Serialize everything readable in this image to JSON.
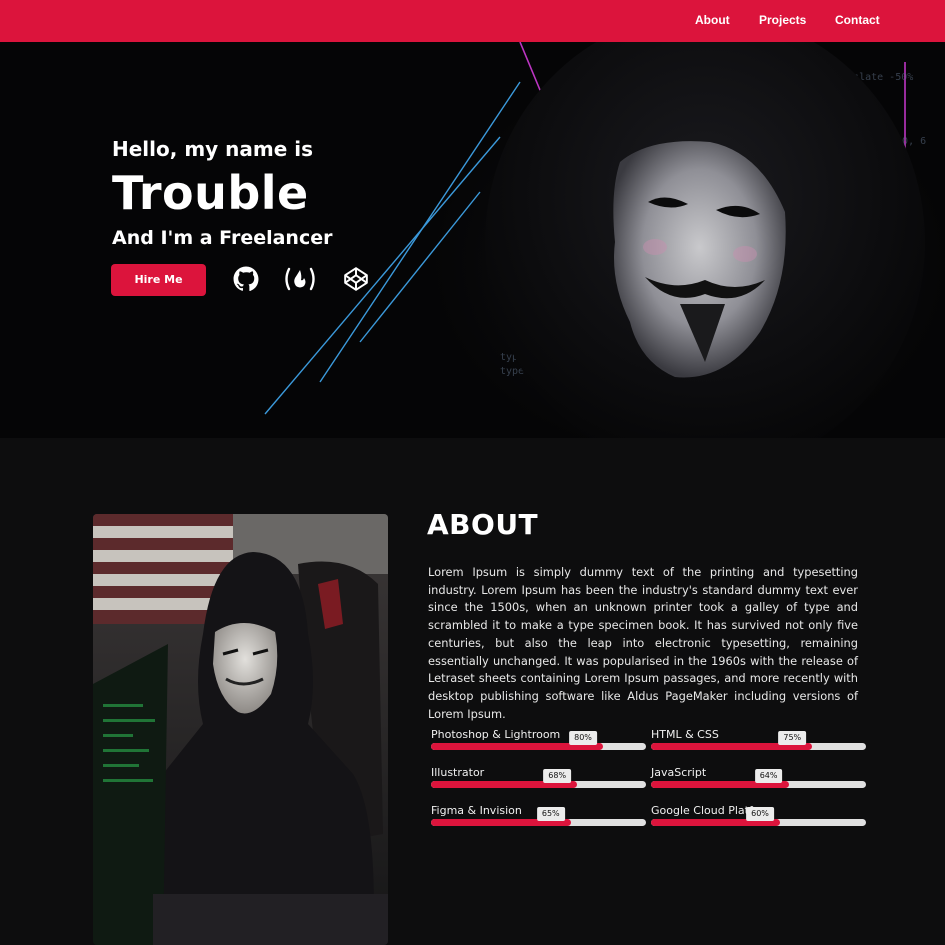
{
  "nav": {
    "items": [
      {
        "label": "About"
      },
      {
        "label": "Projects"
      },
      {
        "label": "Contact"
      }
    ]
  },
  "hero": {
    "greeting": "Hello, my name is",
    "name": "Trouble",
    "role": "And I'm a Freelancer",
    "cta_label": "Hire Me",
    "social_icons": [
      "github-icon",
      "freecodecamp-icon",
      "codepen-icon"
    ]
  },
  "about": {
    "title": "ABOUT",
    "text": "Lorem Ipsum is simply dummy text of the printing and typesetting industry. Lorem Ipsum has been the industry's standard dummy text ever since the 1500s, when an unknown printer took a galley of type and scrambled it to make a type specimen book. It has survived not only five centuries, but also the leap into electronic typesetting, remaining essentially unchanged. It was popularised in the 1960s with the release of Letraset sheets containing Lorem Ipsum passages, and more recently with desktop publishing software like Aldus PageMaker including versions of Lorem Ipsum.",
    "skills": [
      {
        "label": "Photoshop & Lightroom",
        "percent_label": "80%",
        "value": 80
      },
      {
        "label": "HTML & CSS",
        "percent_label": "75%",
        "value": 75
      },
      {
        "label": "Illustrator",
        "percent_label": "68%",
        "value": 68
      },
      {
        "label": "JavaScript",
        "percent_label": "64%",
        "value": 64
      },
      {
        "label": "Figma & Invision",
        "percent_label": "65%",
        "value": 65
      },
      {
        "label": "Google Cloud Platform",
        "percent_label": "60%",
        "value": 60
      }
    ]
  },
  "colors": {
    "accent": "#dc143c",
    "background": "#0d0d0e",
    "track": "#e0e0e0"
  }
}
